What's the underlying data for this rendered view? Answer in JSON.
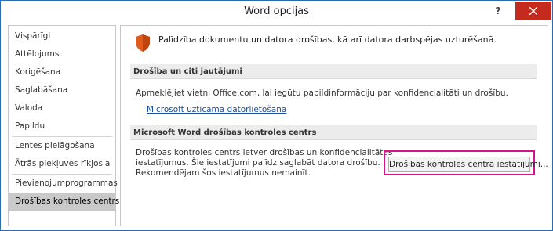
{
  "window": {
    "title": "Word opcijas",
    "help_label": "?"
  },
  "sidebar": {
    "items": [
      {
        "label": "Vispārīgi"
      },
      {
        "label": "Attēlojums"
      },
      {
        "label": "Korigēšana"
      },
      {
        "label": "Saglabāšana"
      },
      {
        "label": "Valoda"
      },
      {
        "label": "Papildu"
      },
      {
        "label": "Lentes pielāgošana"
      },
      {
        "label": "Ātrās piekļuves rīkjosla"
      },
      {
        "label": "Pievienojumprogrammas"
      },
      {
        "label": "Drošības kontroles centrs"
      }
    ],
    "active_index": 9
  },
  "main": {
    "heading": "Palīdzība dokumentu un datora drošības, kā arī datora darbspējas uzturēšanā.",
    "privacy_section": {
      "title": "Drošība un citi jautājumi",
      "text": "Apmeklējiet vietni Office.com, lai iegūtu papildinformāciju par konfidencialitāti un drošību.",
      "link": "Microsoft uzticamā datorlietošana"
    },
    "trust_section": {
      "title": "Microsoft Word drošības kontroles centrs",
      "lines": [
        "Drošības kontroles centrs ietver drošības un konfidencialitātes",
        "iestatījumus. Šie iestatījumi palīdz saglabāt datora drošību.",
        "Rekomendējam šos iestatījumus nemainīt."
      ],
      "button_label": "Drošības kontroles centra iestatījumi..."
    }
  },
  "colors": {
    "accent": "#d8118c",
    "close": "#c42b1c",
    "shield": "#e05a1a",
    "link": "#1a4fa0"
  }
}
